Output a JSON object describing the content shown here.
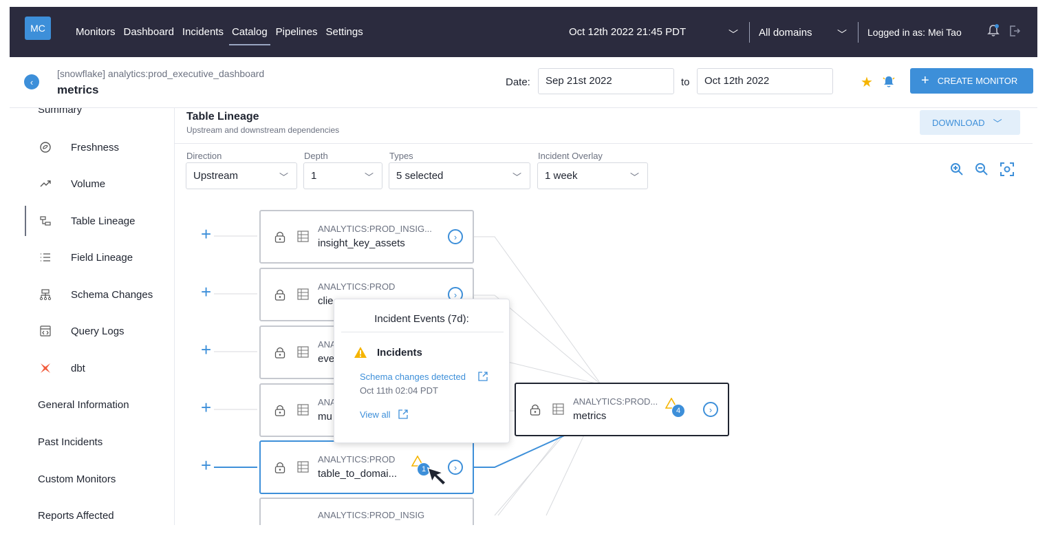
{
  "topbar": {
    "logo": "MC",
    "nav": [
      "Monitors",
      "Dashboard",
      "Incidents",
      "Catalog",
      "Pipelines",
      "Settings"
    ],
    "active_nav": "Catalog",
    "datetime": "Oct 12th 2022 21:45 PDT",
    "domains": "All domains",
    "logged_in": "Logged in as: Mei Tao"
  },
  "subheader": {
    "breadcrumb": "[snowflake] analytics:prod_executive_dashboard",
    "title": "metrics",
    "date_label": "Date:",
    "date_from": "Sep 21st 2022",
    "to_label": "to",
    "date_to": "Oct 12th 2022",
    "create_label": "CREATE MONITOR"
  },
  "sidebar": {
    "summary": "Summary",
    "items": [
      {
        "label": "Freshness",
        "icon": "freshness-icon"
      },
      {
        "label": "Volume",
        "icon": "volume-icon"
      },
      {
        "label": "Table Lineage",
        "icon": "lineage-icon"
      },
      {
        "label": "Field Lineage",
        "icon": "list-icon"
      },
      {
        "label": "Schema Changes",
        "icon": "schema-icon"
      },
      {
        "label": "Query Logs",
        "icon": "query-icon"
      },
      {
        "label": "dbt",
        "icon": "dbt-icon"
      }
    ],
    "sections": [
      "General Information",
      "Past Incidents",
      "Custom Monitors",
      "Reports Affected"
    ]
  },
  "lineage": {
    "title": "Table Lineage",
    "subtitle": "Upstream and downstream dependencies",
    "download": "DOWNLOAD",
    "filters": {
      "direction_label": "Direction",
      "direction_value": "Upstream",
      "depth_label": "Depth",
      "depth_value": "1",
      "types_label": "Types",
      "types_value": "5 selected",
      "overlay_label": "Incident Overlay",
      "overlay_value": "1 week"
    },
    "nodes": [
      {
        "schema": "ANALYTICS:PROD_INSIG...",
        "name": "insight_key_assets"
      },
      {
        "schema": "ANALYTICS:PROD",
        "name": "clie"
      },
      {
        "schema": "ANA",
        "name": "eve"
      },
      {
        "schema": "ANA",
        "name": "mu"
      },
      {
        "schema": "ANALYTICS:PROD",
        "name": "table_to_domai...",
        "badge": "1"
      },
      {
        "schema": "ANALYTICS:PROD_INSIG",
        "name": ""
      }
    ],
    "main_node": {
      "schema": "ANALYTICS:PROD...",
      "name": "metrics",
      "badge": "4"
    }
  },
  "popover": {
    "title": "Incident Events (7d):",
    "heading": "Incidents",
    "event_link": "Schema changes detected",
    "event_time": "Oct 11th 02:04 PDT",
    "view_all": "View all"
  },
  "colors": {
    "topbar": "#2b2b3e",
    "accent": "#3d8fd9",
    "warning": "#f5b400"
  }
}
